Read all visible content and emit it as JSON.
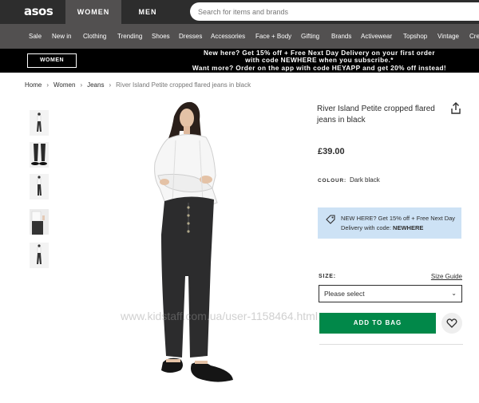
{
  "header": {
    "logo": "asos",
    "gender_tabs": [
      "WOMEN",
      "MEN"
    ],
    "search_placeholder": "Search for items and brands"
  },
  "category_nav": [
    "Sale",
    "New in",
    "Clothing",
    "Trending",
    "Shoes",
    "Dresses",
    "Accessories",
    "Face + Body",
    "Gifting",
    "Brands",
    "Activewear",
    "Topshop",
    "Vintage",
    "Cre"
  ],
  "promo": {
    "button": "WOMEN",
    "lines": [
      "New here? Get 15% off + Free Next Day Delivery on your first order",
      "with code NEWHERE when you subscribe.*",
      "Want more? Order on the app with code HEYAPP and get 20% off instead!"
    ]
  },
  "breadcrumb": {
    "home": "Home",
    "women": "Women",
    "jeans": "Jeans",
    "current": "River Island Petite cropped flared jeans in black",
    "separator": "›"
  },
  "product": {
    "title": "River Island Petite cropped flared jeans in black",
    "price": "£39.00",
    "colour_label": "COLOUR:",
    "colour_value": "Dark black",
    "offer_text": "NEW HERE? Get 15% off + Free Next Day Delivery with code: ",
    "offer_code": "NEWHERE",
    "size_label": "SIZE:",
    "size_guide": "Size Guide",
    "size_select": "Please select",
    "add_to_bag": "ADD TO BAG"
  },
  "watermark": "www.kidstaff.com.ua/user-1158464.html",
  "colors": {
    "header": "#2d2d2d",
    "nav": "#525050",
    "promo": "#000000",
    "green": "#018849",
    "offer_bg": "#cde2f5"
  }
}
